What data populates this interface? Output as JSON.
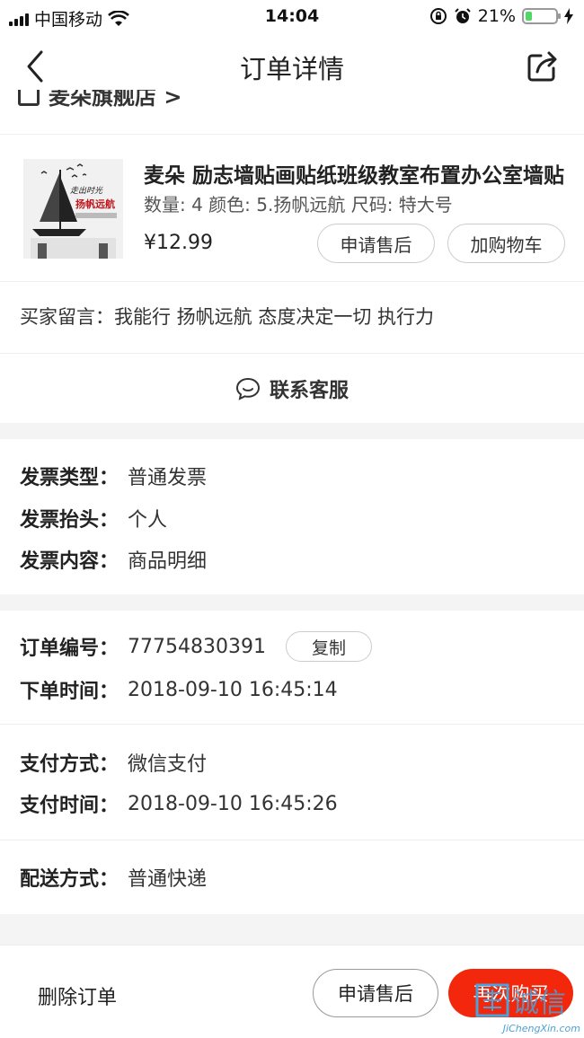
{
  "status_bar": {
    "carrier": "中国移动",
    "time": "14:04",
    "battery": "21%",
    "battery_level": 0.21
  },
  "nav": {
    "title": "订单详情"
  },
  "shop": {
    "name": "麦朵旗舰店 >"
  },
  "product": {
    "image_text_1": "走出时光",
    "image_text_2": "扬帆远航",
    "name": "麦朵 励志墙贴画贴纸班级教室布置办公室墙贴",
    "spec": "数量: 4 颜色: 5.扬帆远航 尺码: 特大号",
    "price": "¥12.99",
    "after_sale_label": "申请售后",
    "add_cart_label": "加购物车"
  },
  "remark": {
    "text": "买家留言：我能行 扬帆远航 态度决定一切 执行力"
  },
  "customer_service": {
    "label": "联系客服"
  },
  "invoice": {
    "type_label": "发票类型：",
    "type_value": "普通发票",
    "title_label": "发票抬头：",
    "title_value": "个人",
    "content_label": "发票内容：",
    "content_value": "商品明细"
  },
  "order": {
    "number_label": "订单编号：",
    "number_value": "77754830391",
    "copy_label": "复制",
    "time_label": "下单时间：",
    "time_value": "2018-09-10 16:45:14"
  },
  "payment": {
    "method_label": "支付方式：",
    "method_value": "微信支付",
    "time_label": "支付时间：",
    "time_value": "2018-09-10 16:45:26"
  },
  "delivery": {
    "method_label": "配送方式：",
    "method_value": "普通快递"
  },
  "bottom_bar": {
    "delete_label": "删除订单",
    "after_sale_label": "申请售后",
    "rebuy_label": "再次购买"
  },
  "watermark": {
    "text": "诚信",
    "site": "JiChengXin.com"
  },
  "colors": {
    "accent": "#f2270c",
    "watermark": "#4aa3d8"
  }
}
